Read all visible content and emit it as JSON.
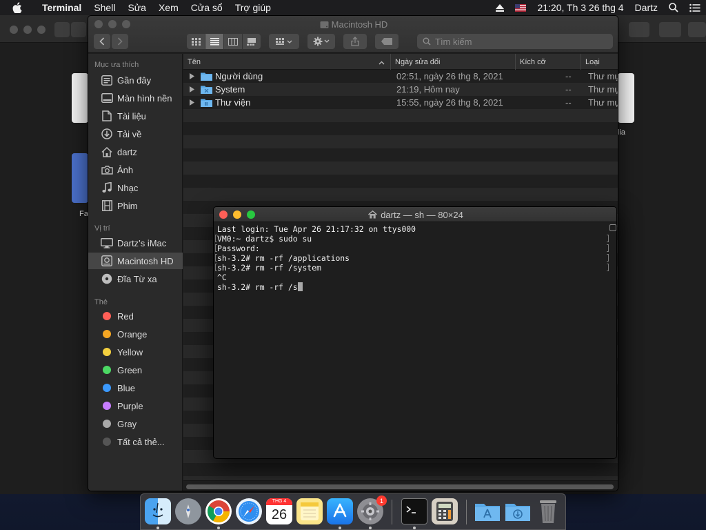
{
  "menubar": {
    "app_name": "Terminal",
    "items": [
      "Shell",
      "Sửa",
      "Xem",
      "Cửa sổ",
      "Trợ giúp"
    ],
    "clock": "21:20, Th 3 26 thg 4",
    "user": "Dartz"
  },
  "background_window": {
    "partial_labels": [
      "Fa",
      "lia"
    ]
  },
  "finder": {
    "title": "Macintosh HD",
    "search_placeholder": "Tìm kiếm",
    "sidebar": {
      "favorites_heading": "Mục ưa thích",
      "favorites": [
        {
          "label": "Gần đây",
          "icon": "recents-icon"
        },
        {
          "label": "Màn hình nền",
          "icon": "desktop-icon"
        },
        {
          "label": "Tài liệu",
          "icon": "documents-icon"
        },
        {
          "label": "Tải về",
          "icon": "downloads-icon"
        },
        {
          "label": "dartz",
          "icon": "home-icon"
        },
        {
          "label": "Ảnh",
          "icon": "camera-icon"
        },
        {
          "label": "Nhạc",
          "icon": "music-icon"
        },
        {
          "label": "Phim",
          "icon": "movies-icon"
        }
      ],
      "locations_heading": "Vị trí",
      "locations": [
        {
          "label": "Dartz’s iMac",
          "icon": "imac-icon"
        },
        {
          "label": "Macintosh HD",
          "icon": "hard-drive-icon",
          "selected": true
        },
        {
          "label": "Đĩa Từ xa",
          "icon": "remote-disc-icon"
        }
      ],
      "tags_heading": "Thẻ",
      "tags": [
        {
          "label": "Red",
          "color": "#ff5f57"
        },
        {
          "label": "Orange",
          "color": "#f5a623"
        },
        {
          "label": "Yellow",
          "color": "#f4d03f"
        },
        {
          "label": "Green",
          "color": "#4cd964"
        },
        {
          "label": "Blue",
          "color": "#3b99fc"
        },
        {
          "label": "Purple",
          "color": "#c77dff"
        },
        {
          "label": "Gray",
          "color": "#a9a9a9"
        },
        {
          "label": "Tất cả thẻ...",
          "color": "#555555"
        }
      ]
    },
    "columns": {
      "name": "Tên",
      "date": "Ngày sửa đổi",
      "size": "Kích cỡ",
      "kind": "Loại"
    },
    "rows": [
      {
        "name": "Người dùng",
        "date": "02:51, ngày 26 thg 8, 2021",
        "size": "--",
        "kind": "Thư mục"
      },
      {
        "name": "System",
        "date": "21:19, Hôm nay",
        "size": "--",
        "kind": "Thư mục"
      },
      {
        "name": "Thư viện",
        "date": "15:55, ngày 26 thg 8, 2021",
        "size": "--",
        "kind": "Thư mục"
      }
    ]
  },
  "terminal": {
    "title": "dartz — sh — 80×24",
    "lines": [
      "Last login: Tue Apr 26 21:17:32 on ttys000",
      "VM0:~ dartz$ sudo su",
      "Password:",
      "sh-3.2# rm -rf /applications",
      "sh-3.2# rm -rf /system",
      "^C",
      "sh-3.2# rm -rf /s"
    ]
  },
  "dock": {
    "calendar_month": "THG 4",
    "calendar_day": "26",
    "badge": "1",
    "apps": [
      "finder-icon",
      "launchpad-icon",
      "chrome-icon",
      "safari-icon",
      "calendar-icon",
      "notes-icon",
      "app-store-icon",
      "system-preferences-icon",
      "terminal-icon",
      "calculator-icon",
      "applications-folder-icon",
      "downloads-folder-icon",
      "trash-icon"
    ]
  }
}
